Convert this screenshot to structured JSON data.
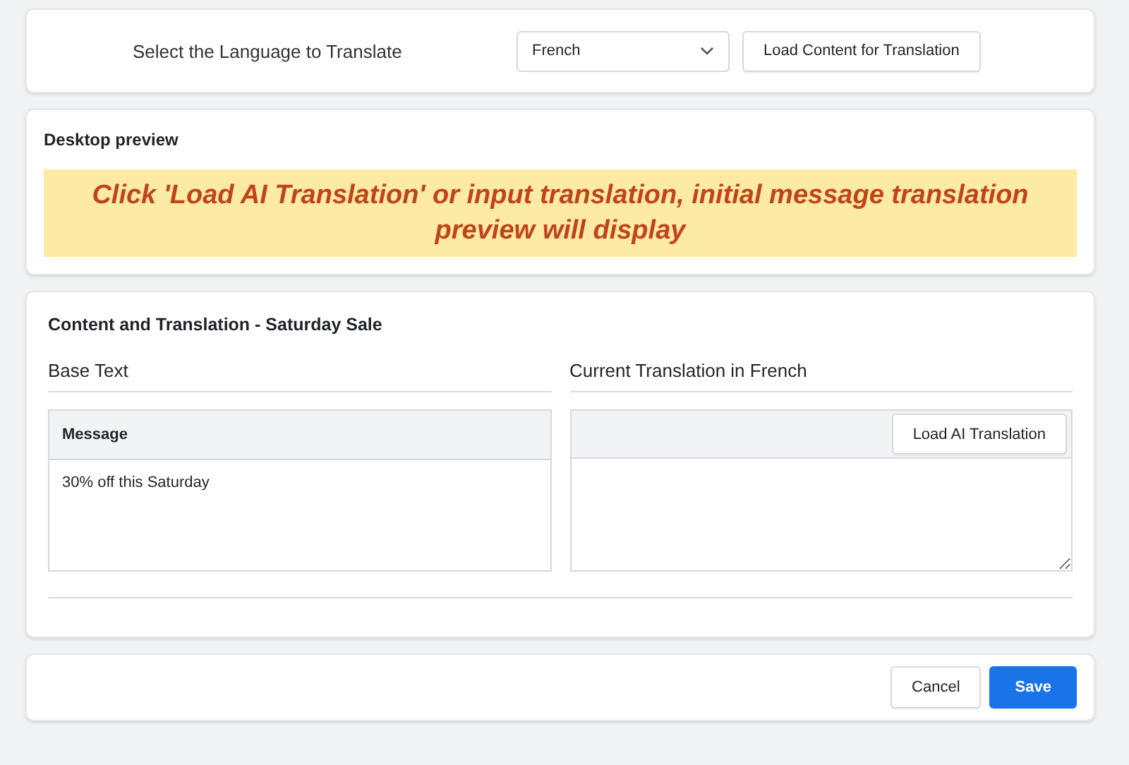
{
  "language_bar": {
    "label": "Select the Language to Translate",
    "language_select": {
      "value": "French"
    },
    "load_button": "Load Content for Translation"
  },
  "preview": {
    "title": "Desktop preview",
    "message": "Click 'Load AI Translation' or input translation, initial message translation preview will display"
  },
  "content": {
    "title": "Content and Translation - Saturday Sale",
    "base": {
      "heading": "Base Text",
      "field_label": "Message",
      "value": "30% off this Saturday"
    },
    "translation": {
      "heading": "Current Translation in French",
      "load_button": "Load AI Translation"
    }
  },
  "footer": {
    "buttons": [
      {
        "label": "Cancel",
        "kind": "secondary"
      },
      {
        "label": "Save",
        "kind": "primary"
      }
    ]
  }
}
